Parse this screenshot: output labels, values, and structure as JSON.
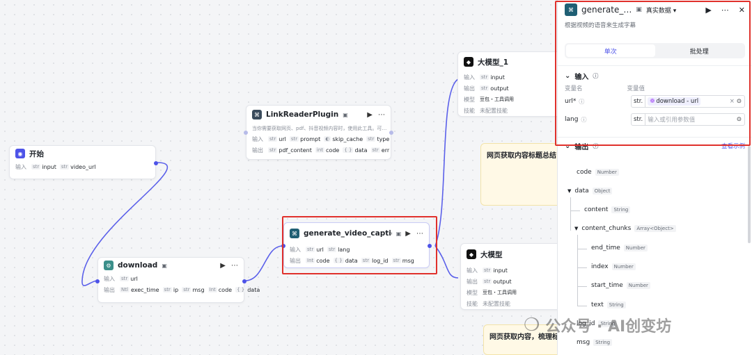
{
  "nodes": {
    "start": {
      "title": "开始",
      "in_label": "输入",
      "tag1_type": "str",
      "tag1": "input",
      "tag2_type": "str",
      "tag2": "video_url"
    },
    "download": {
      "title": "download",
      "in_label": "输入",
      "in_type": "str",
      "in": "url",
      "out_label": "输出",
      "outs": [
        {
          "t": "Ntl",
          "n": "exec_time"
        },
        {
          "t": "str",
          "n": "ip"
        },
        {
          "t": "str",
          "n": "msg"
        },
        {
          "t": "Int",
          "n": "code"
        },
        {
          "t": "{ }",
          "n": "data"
        }
      ]
    },
    "linkreader": {
      "title": "LinkReaderPlugin",
      "desc": "当你需要获取网页、pdf、抖音视频内容时，使用此工具。可…",
      "in_label": "输入",
      "ins": [
        {
          "t": "str",
          "n": "url"
        },
        {
          "t": "str",
          "n": "prompt"
        },
        {
          "t": "◐",
          "n": "skip_cache"
        },
        {
          "t": "str",
          "n": "type"
        }
      ],
      "out_label": "输出",
      "outs": [
        {
          "t": "str",
          "n": "pdf_content"
        },
        {
          "t": "int",
          "n": "code"
        },
        {
          "t": "{ }",
          "n": "data"
        },
        {
          "t": "str",
          "n": "err"
        }
      ]
    },
    "gen": {
      "title": "generate_video_captions_s…",
      "in_label": "输入",
      "ins": [
        {
          "t": "str",
          "n": "url"
        },
        {
          "t": "str",
          "n": "lang"
        }
      ],
      "out_label": "输出",
      "outs": [
        {
          "t": "Int",
          "n": "code"
        },
        {
          "t": "{ }",
          "n": "data"
        },
        {
          "t": "str",
          "n": "log_id"
        },
        {
          "t": "str",
          "n": "msg"
        }
      ]
    },
    "llm1": {
      "title": "大模型_1",
      "in_label": "输入",
      "in_type": "str",
      "in": "input",
      "out_label": "输出",
      "out_type": "str",
      "out": "output",
      "model_label": "模型",
      "model": "豆包・工具调用",
      "skill_label": "技能",
      "skill": "未配置技能"
    },
    "llm2": {
      "title": "大模型",
      "in_label": "输入",
      "in_type": "str",
      "in": "input",
      "out_label": "输出",
      "out_type": "str",
      "out": "output",
      "model_label": "模型",
      "model": "豆包・工具调用",
      "skill_label": "技能",
      "skill": "未配置技能"
    }
  },
  "notes": {
    "note1": "网页获取内容标题总结",
    "note2": "网页获取内容，梳理标"
  },
  "panel": {
    "title": "generate_…",
    "data_mode": "真实数据",
    "subtitle": "根据视频的语音来生成字幕",
    "tabs": [
      "单次",
      "批处理"
    ],
    "input_section": "输入",
    "col_name": "变量名",
    "col_value": "变量值",
    "params": [
      {
        "name": "url*",
        "type": "str.",
        "value": "download - url",
        "placeholder": ""
      },
      {
        "name": "lang",
        "type": "str.",
        "value": "",
        "placeholder": "输入或引用参数值"
      }
    ],
    "output_section": "输出",
    "view_example": "查看示例",
    "outputs": [
      {
        "name": "code",
        "type": "Number"
      },
      {
        "name": "data",
        "type": "Object"
      },
      {
        "name": "content",
        "type": "String"
      },
      {
        "name": "content_chunks",
        "type": "Array<Object>"
      },
      {
        "name": "end_time",
        "type": "Number"
      },
      {
        "name": "index",
        "type": "Number"
      },
      {
        "name": "start_time",
        "type": "Number"
      },
      {
        "name": "text",
        "type": "String"
      },
      {
        "name": "log_id",
        "type": "String"
      },
      {
        "name": "msg",
        "type": "String"
      }
    ]
  },
  "watermark": "公众号 · AI创变坊",
  "colors": {
    "accent": "#4d53e8",
    "highlight": "#e0302b",
    "note_bg": "#fff9e6"
  }
}
